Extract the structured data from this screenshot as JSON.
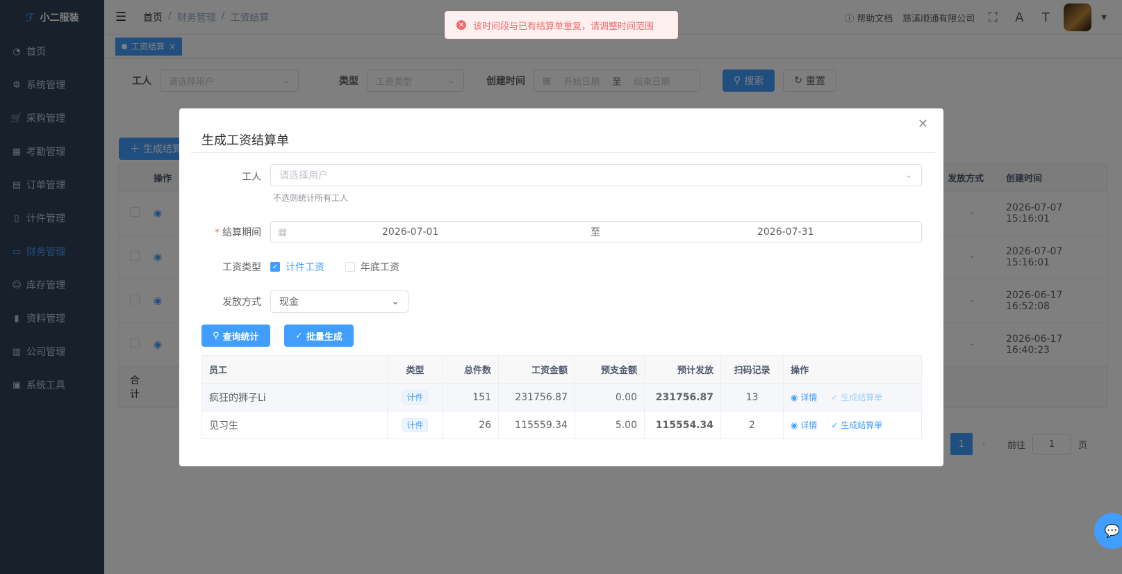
{
  "app": {
    "title": "小二服装",
    "logo_mark": "ℱ"
  },
  "sidebar": {
    "items": [
      {
        "icon": "dashboard-icon",
        "label": "首页"
      },
      {
        "icon": "gear-icon",
        "label": "系统管理"
      },
      {
        "icon": "cart-icon",
        "label": "采购管理"
      },
      {
        "icon": "grid-icon",
        "label": "考勤管理"
      },
      {
        "icon": "form-icon",
        "label": "订单管理"
      },
      {
        "icon": "book-icon",
        "label": "计件管理"
      },
      {
        "icon": "monitor-icon",
        "label": "财务管理",
        "active": true
      },
      {
        "icon": "user-icon",
        "label": "库存管理"
      },
      {
        "icon": "document-icon",
        "label": "资料管理"
      },
      {
        "icon": "chart-icon",
        "label": "公司管理"
      },
      {
        "icon": "toolbox-icon",
        "label": "系统工具"
      }
    ]
  },
  "navbar": {
    "breadcrumb": [
      "首页",
      "财务管理",
      "工资结算"
    ],
    "help": "帮助文档",
    "company": "慈溪顺通有限公司"
  },
  "tagsview": {
    "active": "工资结算"
  },
  "search": {
    "worker_label": "工人",
    "worker_placeholder": "请选择用户",
    "type_label": "类型",
    "type_placeholder": "工资类型",
    "time_label": "创建时间",
    "start_placeholder": "开始日期",
    "to": "至",
    "end_placeholder": "结束日期",
    "search_btn": "搜索",
    "reset_btn": "重置"
  },
  "background": {
    "generate_btn": "生成结算",
    "col_op": "操作",
    "col_pay": "发放方式",
    "col_created": "创建时间",
    "rows": [
      {
        "pay": "-",
        "created": "2026-07-07 15:16:01"
      },
      {
        "pay": "-",
        "created": "2026-07-07 15:16:01"
      },
      {
        "pay": "-",
        "created": "2026-06-17 16:52:08"
      },
      {
        "pay": "-",
        "created": "2026-06-17 16:40:23"
      }
    ],
    "total_label": "合计",
    "page": "1",
    "goto": "前往",
    "goto_value": "1",
    "page_suffix": "页"
  },
  "toast": {
    "message": "该时间段与已有结算单重复，请调整时间范围"
  },
  "dialog": {
    "title": "生成工资结算单",
    "worker_label": "工人",
    "worker_placeholder": "请选择用户",
    "worker_hint": "不选则统计所有工人",
    "period_label": "结算期间",
    "period_start": "2026-07-01",
    "period_to": "至",
    "period_end": "2026-07-31",
    "type_label": "工资类型",
    "type_piece": "计件工资",
    "type_year": "年底工资",
    "pay_label": "发放方式",
    "pay_value": "现金",
    "query_btn": "查询统计",
    "batch_btn": "批量生成",
    "columns": [
      "员工",
      "类型",
      "总件数",
      "工资金额",
      "预支金额",
      "预计发放",
      "扫码记录",
      "操作"
    ],
    "rows": [
      {
        "name": "疯狂的狮子Li",
        "type": "计件",
        "count": "151",
        "salary": "231756.87",
        "advance": "0.00",
        "expected": "231756.87",
        "scans": "13",
        "detail": "详情",
        "gen": "生成结算单"
      },
      {
        "name": "见习生",
        "type": "计件",
        "count": "26",
        "salary": "115559.34",
        "advance": "5.00",
        "expected": "115554.34",
        "scans": "2",
        "detail": "详情",
        "gen": "生成结算单"
      }
    ]
  }
}
